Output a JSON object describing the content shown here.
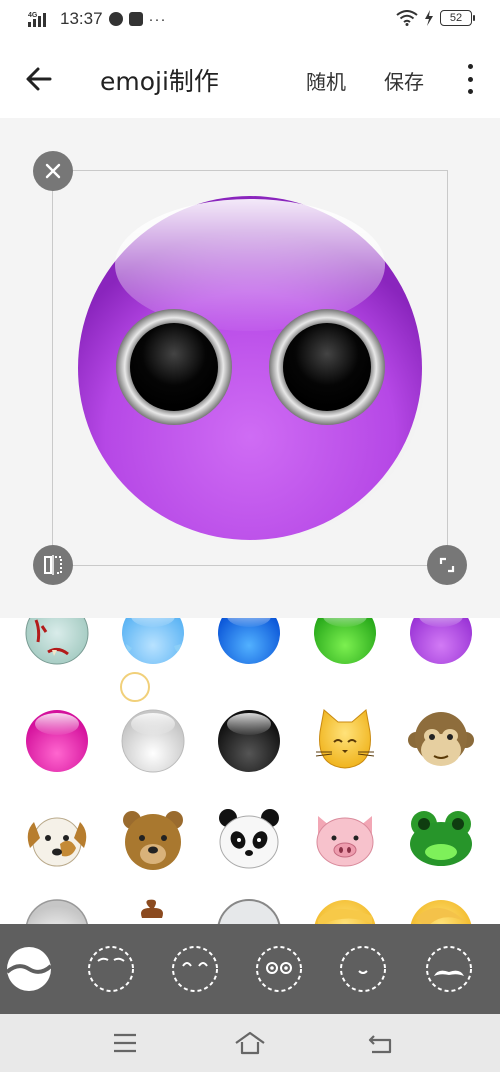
{
  "status_bar": {
    "network": "4G",
    "time": "13:37",
    "dots": "···",
    "battery": "52"
  },
  "app_bar": {
    "title": "emoji制作",
    "random_label": "随机",
    "save_label": "保存"
  },
  "canvas": {
    "emoji_color": "#b44ae6"
  },
  "palette": {
    "rows": [
      [
        "zombie-face",
        "light-blue-drip-face",
        "blue-face",
        "green-face",
        "purple-face"
      ],
      [
        "pink-face",
        "white-face",
        "black-face",
        "cat-face",
        "monkey-face"
      ],
      [
        "dog-face",
        "bear-face",
        "panda-face",
        "pig-face",
        "frog-face"
      ],
      [
        "grey-face",
        "poop",
        "light-grey-face",
        "blonde-hair-face",
        "blonde-hair-face-2"
      ]
    ]
  },
  "tabs": [
    "face-shape-tab",
    "eyebrows-tab",
    "eyes-closed-tab",
    "eyes-tab",
    "mouth-tab",
    "mustache-tab"
  ],
  "colors": {
    "tab_bar": "#5f5f5f",
    "canvas_bg": "#f4f4f4"
  }
}
